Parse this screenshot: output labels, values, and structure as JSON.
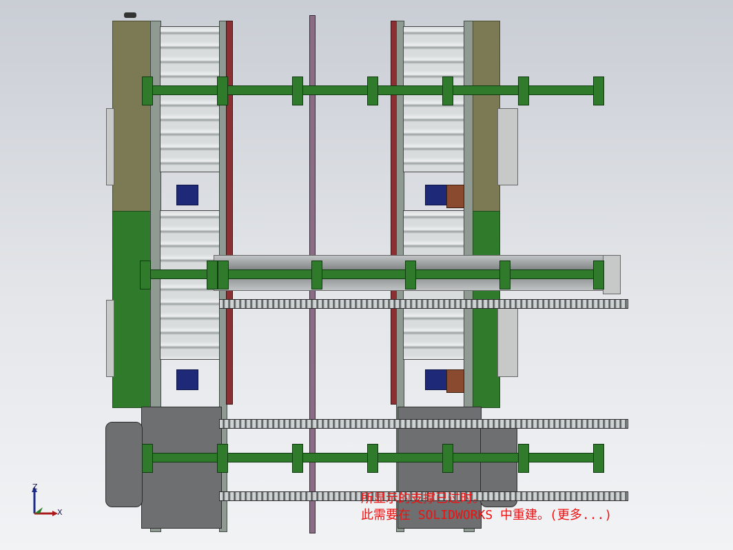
{
  "notice": {
    "line1": "所显示的支撑已过时。",
    "line2": "此需要在 SOLIDWORKS 中重建。(更多...)"
  },
  "triad": {
    "z_label": "Z",
    "x_label": "X"
  },
  "colors": {
    "background": "#d6d9de",
    "olive_panel": "#7b7a55",
    "green_panel": "#2f7a2b",
    "notice_text": "#ee1111",
    "motor": "#1e2a77"
  }
}
